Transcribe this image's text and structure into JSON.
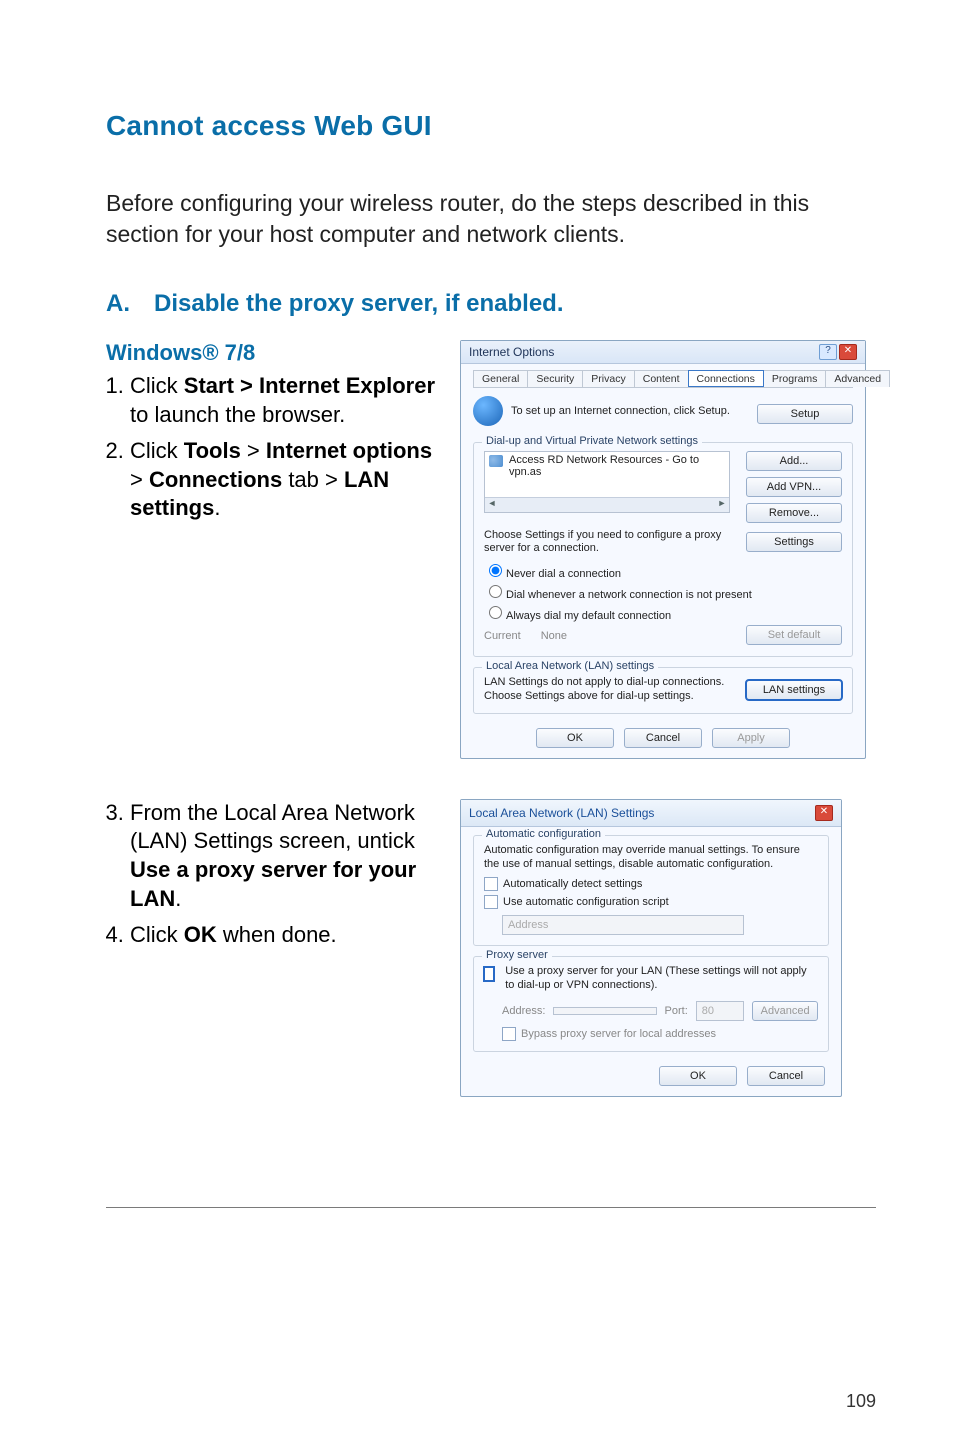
{
  "heading_main": "Cannot access Web GUI",
  "intro_text": "Before configuring your wireless router, do the steps described in this section for your host computer and network clients.",
  "section_a": "A. Disable the proxy server, if enabled.",
  "subheading": "Windows® 7/8",
  "steps12": {
    "s1a": "Click ",
    "s1b": "Start > Internet Explorer",
    "s1c": " to launch the browser.",
    "s2a": "Click ",
    "s2b": "Tools",
    "s2c": " > ",
    "s2d": "Internet options",
    "s2e": " > ",
    "s2f": "Connections",
    "s2g": " tab > ",
    "s2h": "LAN settings",
    "s2i": "."
  },
  "steps34": {
    "s3a": "From the Local Area Network (LAN) Settings screen, untick ",
    "s3b": "Use a proxy server for your LAN",
    "s3c": ".",
    "s4a": "Click ",
    "s4b": "OK",
    "s4c": " when done."
  },
  "dialog1": {
    "title": "Internet Options",
    "tabs": {
      "general": "General",
      "security": "Security",
      "privacy": "Privacy",
      "content": "Content",
      "connections": "Connections",
      "programs": "Programs",
      "advanced": "Advanced"
    },
    "setup_text": "To set up an Internet connection, click Setup.",
    "setup_btn": "Setup",
    "dialup_legend": "Dial-up and Virtual Private Network settings",
    "list_item": "Access RD Network Resources - Go to vpn.as",
    "btn_add": "Add...",
    "btn_add_vpn": "Add VPN...",
    "btn_remove": "Remove...",
    "choose_text": "Choose Settings if you need to configure a proxy server for a connection.",
    "btn_settings": "Settings",
    "radio_never": "Never dial a connection",
    "radio_dial": "Dial whenever a network connection is not present",
    "radio_always": "Always dial my default connection",
    "current_label": "Current",
    "current_value": "None",
    "btn_setdefault": "Set default",
    "lan_legend": "Local Area Network (LAN) settings",
    "lan_text": "LAN Settings do not apply to dial-up connections. Choose Settings above for dial-up settings.",
    "btn_lan": "LAN settings",
    "btn_ok": "OK",
    "btn_cancel": "Cancel",
    "btn_apply": "Apply"
  },
  "dialog2": {
    "title": "Local Area Network (LAN) Settings",
    "auto_legend": "Automatic configuration",
    "auto_text": "Automatic configuration may override manual settings.  To ensure the use of manual settings, disable automatic configuration.",
    "chk_detect": "Automatically detect settings",
    "chk_script": "Use automatic configuration script",
    "addr_placeholder": "Address",
    "proxy_legend": "Proxy server",
    "chk_proxy": "Use a proxy server for your LAN (These settings will not apply to dial-up or VPN connections).",
    "addr_label": "Address:",
    "port_label": "Port:",
    "port_value": "80",
    "btn_advanced": "Advanced",
    "chk_bypass": "Bypass proxy server for local addresses",
    "btn_ok": "OK",
    "btn_cancel": "Cancel"
  },
  "page_number": "109"
}
